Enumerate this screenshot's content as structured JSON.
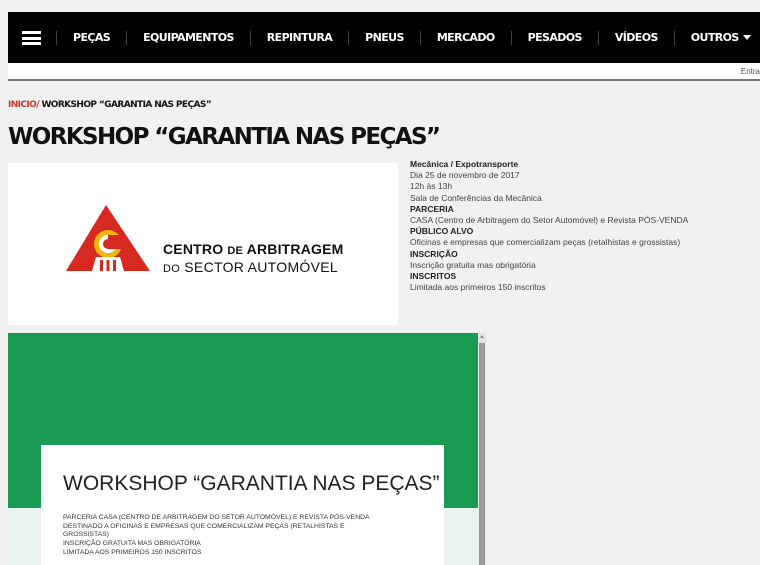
{
  "nav": {
    "items": [
      {
        "label": "PEÇAS"
      },
      {
        "label": "EQUIPAMENTOS"
      },
      {
        "label": "REPINTURA"
      },
      {
        "label": "PNEUS"
      },
      {
        "label": "MERCADO"
      },
      {
        "label": "PESADOS"
      },
      {
        "label": "VÍDEOS"
      },
      {
        "label": "OUTROS"
      }
    ],
    "login_label": "Entra"
  },
  "breadcrumb": {
    "home": "INICIO/",
    "current": " WORKSHOP “GARANTIA NAS PEÇAS”"
  },
  "page": {
    "title": "WORKSHOP “GARANTIA NAS PEÇAS”"
  },
  "logo": {
    "line1_a": "CENTRO ",
    "line1_b": "DE",
    "line1_c": " ARBITRAGEM",
    "line2_a": "DO",
    "line2_b": " SECTOR AUTOMÓVEL"
  },
  "info": {
    "event": "Mecânica / Expotransporte",
    "date": "Dia 25 de novembro de 2017",
    "time": "12h às 13h",
    "place": "Sala de Conferências da Mecânica",
    "partnership_label": "PARCERIA",
    "partnership": "CASA (Centro de Arbitragem do Setor Automóvel) e Revista PÓS-VENDA",
    "audience_label": "PÚBLICO ALVO",
    "audience": "Oficinas e empresas que comercializam peças (retalhistas e grossistas)",
    "registration_label": "INSCRIÇÃO",
    "registration": "Inscrição gratuita mas obrigatória",
    "registered_label": "INSCRITOS",
    "registered": "Limitada aos primeiros 150 inscritos"
  },
  "media": {
    "title": "WORKSHOP “GARANTIA NAS PEÇAS”",
    "lines": [
      "PARCERIA CASA (CENTRO DE ARBITRAGEM DO SETOR AUTOMÓVEL) E REVISTA PÓS-VENDA",
      "DESTINADO A OFICINAS E EMPRESAS QUE COMERCIALIZAM PEÇAS (RETALHISTAS E",
      "GROSSISTAS)",
      "INSCRIÇÃO GRATUITA MAS OBRIGATÓRIA",
      "LIMITADA AOS PRIMEIROS 150 INSCRITOS"
    ]
  },
  "colors": {
    "nav_bg": "#000000",
    "brand_green": "#1a9a52",
    "logo_red": "#d62a20",
    "logo_yellow": "#f2b70e"
  }
}
